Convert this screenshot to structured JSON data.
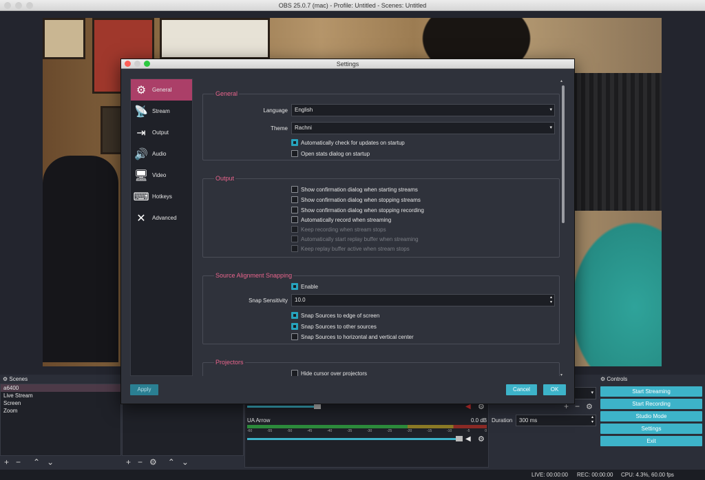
{
  "window": {
    "title": "OBS 25.0.7 (mac) - Profile: Untitled - Scenes: Untitled"
  },
  "scenes": {
    "title": "Scenes",
    "items": [
      "a6400",
      "Live Stream",
      "Screen",
      "Zoom"
    ]
  },
  "mixer": {
    "track_name": "UA Arrow",
    "track_db": "0.0 dB",
    "meter_ticks": [
      "-60",
      "-55",
      "-50",
      "-45",
      "-40",
      "-35",
      "-30",
      "-25",
      "-20",
      "-15",
      "-10",
      "-5",
      "0"
    ]
  },
  "transitions": {
    "duration_label": "Duration",
    "duration_value": "300 ms"
  },
  "controls": {
    "title": "Controls",
    "buttons": [
      "Start Streaming",
      "Start Recording",
      "Studio Mode",
      "Settings",
      "Exit"
    ]
  },
  "status": {
    "live": "LIVE: 00:00:00",
    "rec": "REC: 00:00:00",
    "cpu": "CPU: 4.3%, 60.00 fps"
  },
  "dialog": {
    "title": "Settings",
    "sidebar": [
      {
        "label": "General",
        "icon": "gear-icon"
      },
      {
        "label": "Stream",
        "icon": "antenna-icon"
      },
      {
        "label": "Output",
        "icon": "output-icon"
      },
      {
        "label": "Audio",
        "icon": "speaker-icon"
      },
      {
        "label": "Video",
        "icon": "monitor-icon"
      },
      {
        "label": "Hotkeys",
        "icon": "keyboard-icon"
      },
      {
        "label": "Advanced",
        "icon": "tools-icon"
      }
    ],
    "general": {
      "title": "General",
      "language_label": "Language",
      "language_value": "English",
      "theme_label": "Theme",
      "theme_value": "Rachni",
      "check_updates": "Automatically check for updates on startup",
      "open_stats": "Open stats dialog on startup"
    },
    "output": {
      "title": "Output",
      "items": [
        {
          "label": "Show confirmation dialog when starting streams",
          "checked": false,
          "disabled": false
        },
        {
          "label": "Show confirmation dialog when stopping streams",
          "checked": false,
          "disabled": false
        },
        {
          "label": "Show confirmation dialog when stopping recording",
          "checked": false,
          "disabled": false
        },
        {
          "label": "Automatically record when streaming",
          "checked": false,
          "disabled": false
        },
        {
          "label": "Keep recording when stream stops",
          "checked": false,
          "disabled": true
        },
        {
          "label": "Automatically start replay buffer when streaming",
          "checked": false,
          "disabled": true
        },
        {
          "label": "Keep replay buffer active when stream stops",
          "checked": false,
          "disabled": true
        }
      ]
    },
    "snapping": {
      "title": "Source Alignment Snapping",
      "enable": "Enable",
      "sensitivity_label": "Snap Sensitivity",
      "sensitivity_value": "10.0",
      "edge": "Snap Sources to edge of screen",
      "other": "Snap Sources to other sources",
      "center": "Snap Sources to horizontal and vertical center"
    },
    "projectors": {
      "title": "Projectors",
      "hide_cursor": "Hide cursor over projectors"
    },
    "buttons": {
      "apply": "Apply",
      "cancel": "Cancel",
      "ok": "OK"
    }
  },
  "colors": {
    "accent_pink": "#e9658d",
    "accent_cyan": "#3db3c9",
    "selected_sidebar": "#ab3f68"
  }
}
